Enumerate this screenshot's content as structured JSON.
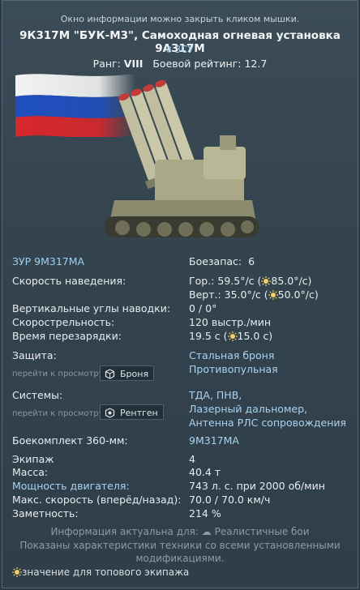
{
  "window": {
    "hint": "Окно информации можно закрыть кликом мышки.",
    "title": "9К317М \"БУК-М3\", Самоходная огневая установка 9А317М",
    "class_label": "ЗСУ",
    "rank_label": "Ранг:",
    "rank_value": "VIII",
    "br_label": "Боевой рейтинг:",
    "br_value": "12.7"
  },
  "stats": {
    "missile_label": "ЗУР 9М317МА",
    "ammo_label": "Боезапас:",
    "ammo_value": "6",
    "traverse_label": "Скорость наведения:",
    "traverse_h": "Гор.: 59.5°/с (",
    "traverse_h_top": "85.0°/с)",
    "traverse_v": "Верт.: 35.0°/с (",
    "traverse_v_top": "50.0°/с)",
    "vangles_label": "Вертикальные углы наводки:",
    "vangles_value": "0 / 0°",
    "rof_label": "Скорострельность:",
    "rof_value": "120 выстр./мин",
    "reload_label": "Время перезарядки:",
    "reload_value": "19.5 с (",
    "reload_top": "15.0 с)",
    "protection_label": "Защита:",
    "protection_values": [
      "Стальная броня",
      "Противопульная"
    ],
    "goto_label": "перейти к просмотру",
    "armor_button": "Броня",
    "systems_label": "Системы:",
    "systems_values": [
      "ТДА, ПНВ,",
      "Лазерный дальномер,",
      "Антенна РЛС сопровождения"
    ],
    "xray_button": "Рентген",
    "ammo_360_label": "Боекомплект 360-мм:",
    "ammo_360_value": "9М317МА",
    "crew_label": "Экипаж",
    "crew_value": "4",
    "mass_label": "Масса:",
    "mass_value": "40.4 т",
    "engine_label": "Мощность двигателя:",
    "engine_value": "743 л. с. при 2000 об/мин",
    "speed_label": "Макс. скорость (вперёд/назад):",
    "speed_value": "70.0 / 70.0 км/ч",
    "visibility_label": "Заметность:",
    "visibility_value": "214 %"
  },
  "footer": {
    "relevance": "Информация актуальна для:",
    "mode": "Реалистичные бои",
    "note1": "Показаны характеристики техники со всеми установленными",
    "note2": "модификациями.",
    "legend": "значение для топового экипажа"
  },
  "colors": {
    "accent": "#9fd0ee",
    "text": "#e8ecef",
    "dim": "#8a979f"
  }
}
